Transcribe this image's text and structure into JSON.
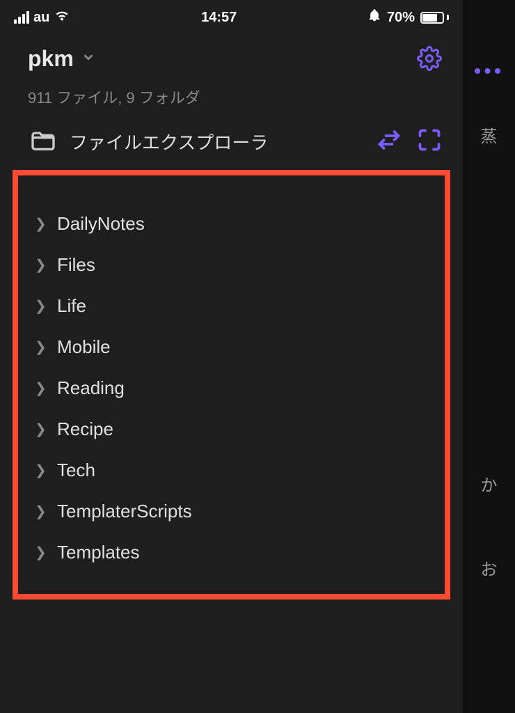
{
  "statusbar": {
    "carrier": "au",
    "time": "14:57",
    "battery_pct": "70%"
  },
  "vault": {
    "name": "pkm",
    "stats": "911 ファイル, 9 フォルダ"
  },
  "explorer": {
    "title": "ファイルエクスプローラ"
  },
  "folders": [
    {
      "name": "DailyNotes"
    },
    {
      "name": "Files"
    },
    {
      "name": "Life"
    },
    {
      "name": "Mobile"
    },
    {
      "name": "Reading"
    },
    {
      "name": "Recipe"
    },
    {
      "name": "Tech"
    },
    {
      "name": "TemplaterScripts"
    },
    {
      "name": "Templates"
    }
  ],
  "back_panel": {
    "char1": "蒸",
    "char2": "か",
    "char3": "お"
  },
  "colors": {
    "accent": "#7b5cff",
    "highlight_border": "#ff4b33",
    "bg": "#1e1e1e"
  }
}
